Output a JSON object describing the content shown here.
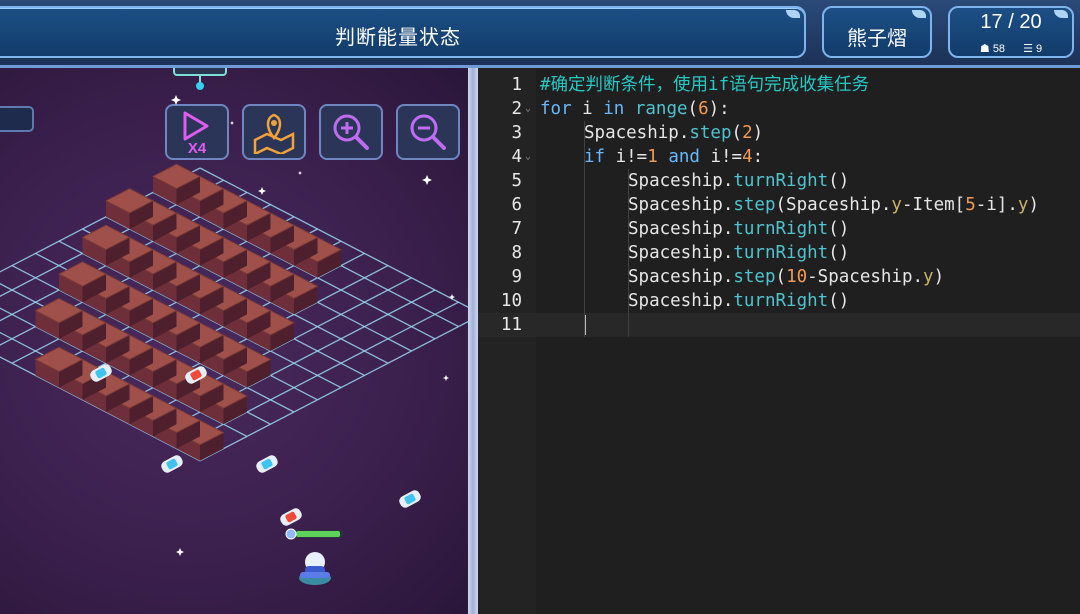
{
  "header": {
    "title": "判断能量状态",
    "player_name": "熊子熠",
    "progress": "17 / 20",
    "stat_a_icon": "☗",
    "stat_a": "58",
    "stat_b_icon": "☰",
    "stat_b": "9"
  },
  "toolbar": {
    "speed_label": "X4",
    "icons": [
      "play-speed-icon",
      "map-pin-icon",
      "zoom-in-icon",
      "zoom-out-icon"
    ]
  },
  "editor": {
    "lines": [
      {
        "n": "1",
        "indent": 0,
        "tokens": [
          [
            "c-com",
            "#确定判断条件，使用if语句完成收集任务"
          ]
        ]
      },
      {
        "n": "2",
        "indent": 0,
        "fold": true,
        "tokens": [
          [
            "c-kw",
            "for"
          ],
          [
            "c-plain",
            " i "
          ],
          [
            "c-kw",
            "in"
          ],
          [
            "c-plain",
            " "
          ],
          [
            "c-fn",
            "range"
          ],
          [
            "c-plain",
            "("
          ],
          [
            "c-num",
            "6"
          ],
          [
            "c-plain",
            "):"
          ]
        ]
      },
      {
        "n": "3",
        "indent": 1,
        "tokens": [
          [
            "c-plain",
            "Spaceship."
          ],
          [
            "c-fn",
            "step"
          ],
          [
            "c-plain",
            "("
          ],
          [
            "c-num",
            "2"
          ],
          [
            "c-plain",
            ")"
          ]
        ]
      },
      {
        "n": "4",
        "indent": 1,
        "fold": true,
        "tokens": [
          [
            "c-kw",
            "if"
          ],
          [
            "c-plain",
            " i!="
          ],
          [
            "c-num",
            "1"
          ],
          [
            "c-plain",
            " "
          ],
          [
            "c-kw",
            "and"
          ],
          [
            "c-plain",
            " i!="
          ],
          [
            "c-num",
            "4"
          ],
          [
            "c-plain",
            ":"
          ]
        ]
      },
      {
        "n": "5",
        "indent": 2,
        "tokens": [
          [
            "c-plain",
            "Spaceship."
          ],
          [
            "c-fn",
            "turnRight"
          ],
          [
            "c-plain",
            "()"
          ]
        ]
      },
      {
        "n": "6",
        "indent": 2,
        "tokens": [
          [
            "c-plain",
            "Spaceship."
          ],
          [
            "c-fn",
            "step"
          ],
          [
            "c-plain",
            "(Spaceship."
          ],
          [
            "c-attr",
            "y"
          ],
          [
            "c-plain",
            "-Item["
          ],
          [
            "c-num",
            "5"
          ],
          [
            "c-plain",
            "-i]."
          ],
          [
            "c-attr",
            "y"
          ],
          [
            "c-plain",
            ")"
          ]
        ]
      },
      {
        "n": "7",
        "indent": 2,
        "tokens": [
          [
            "c-plain",
            "Spaceship."
          ],
          [
            "c-fn",
            "turnRight"
          ],
          [
            "c-plain",
            "()"
          ]
        ]
      },
      {
        "n": "8",
        "indent": 2,
        "tokens": [
          [
            "c-plain",
            "Spaceship."
          ],
          [
            "c-fn",
            "turnRight"
          ],
          [
            "c-plain",
            "()"
          ]
        ]
      },
      {
        "n": "9",
        "indent": 2,
        "tokens": [
          [
            "c-plain",
            "Spaceship."
          ],
          [
            "c-fn",
            "step"
          ],
          [
            "c-plain",
            "("
          ],
          [
            "c-num",
            "10"
          ],
          [
            "c-plain",
            "-Spaceship."
          ],
          [
            "c-attr",
            "y"
          ],
          [
            "c-plain",
            ")"
          ]
        ]
      },
      {
        "n": "10",
        "indent": 2,
        "tokens": [
          [
            "c-plain",
            "Spaceship."
          ],
          [
            "c-fn",
            "turnRight"
          ],
          [
            "c-plain",
            "()"
          ]
        ]
      },
      {
        "n": "11",
        "indent": 0,
        "active": true,
        "tokens": []
      }
    ]
  },
  "colors": {
    "comment": "#27c8c4",
    "keyword": "#69b7ff",
    "number": "#f29a58",
    "function": "#4fc3d0"
  }
}
